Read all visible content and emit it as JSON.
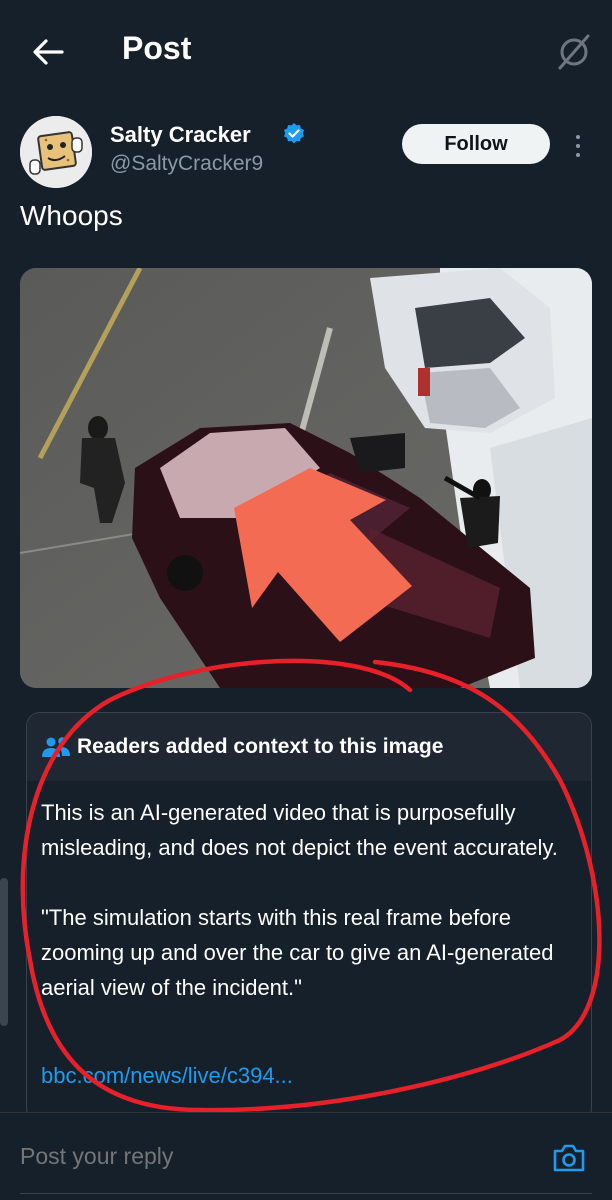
{
  "header": {
    "title": "Post",
    "back_icon": "arrow-left-icon",
    "grok_icon": "grok-slash-icon"
  },
  "author": {
    "display_name": "Salty Cracker",
    "handle": "@SaltyCracker9",
    "verified": true,
    "verified_color": "#1d9bf0",
    "follow_label": "Follow"
  },
  "post": {
    "text": "Whoops"
  },
  "community_note": {
    "title": "Readers added context to this image",
    "paragraphs": [
      "This is an AI-generated video that is purposefully misleading, and does not depict the event accurately.",
      "\"The simulation starts with this real frame before zooming up and over the car to give an AI-generated aerial view of the incident.\""
    ],
    "link": "bbc.com/news/live/c394..."
  },
  "reply": {
    "placeholder": "Post your reply"
  },
  "colors": {
    "background": "#15202b",
    "accent": "#1d9bf0",
    "annotation": "#e8202a",
    "arrow": "#f26b52"
  }
}
